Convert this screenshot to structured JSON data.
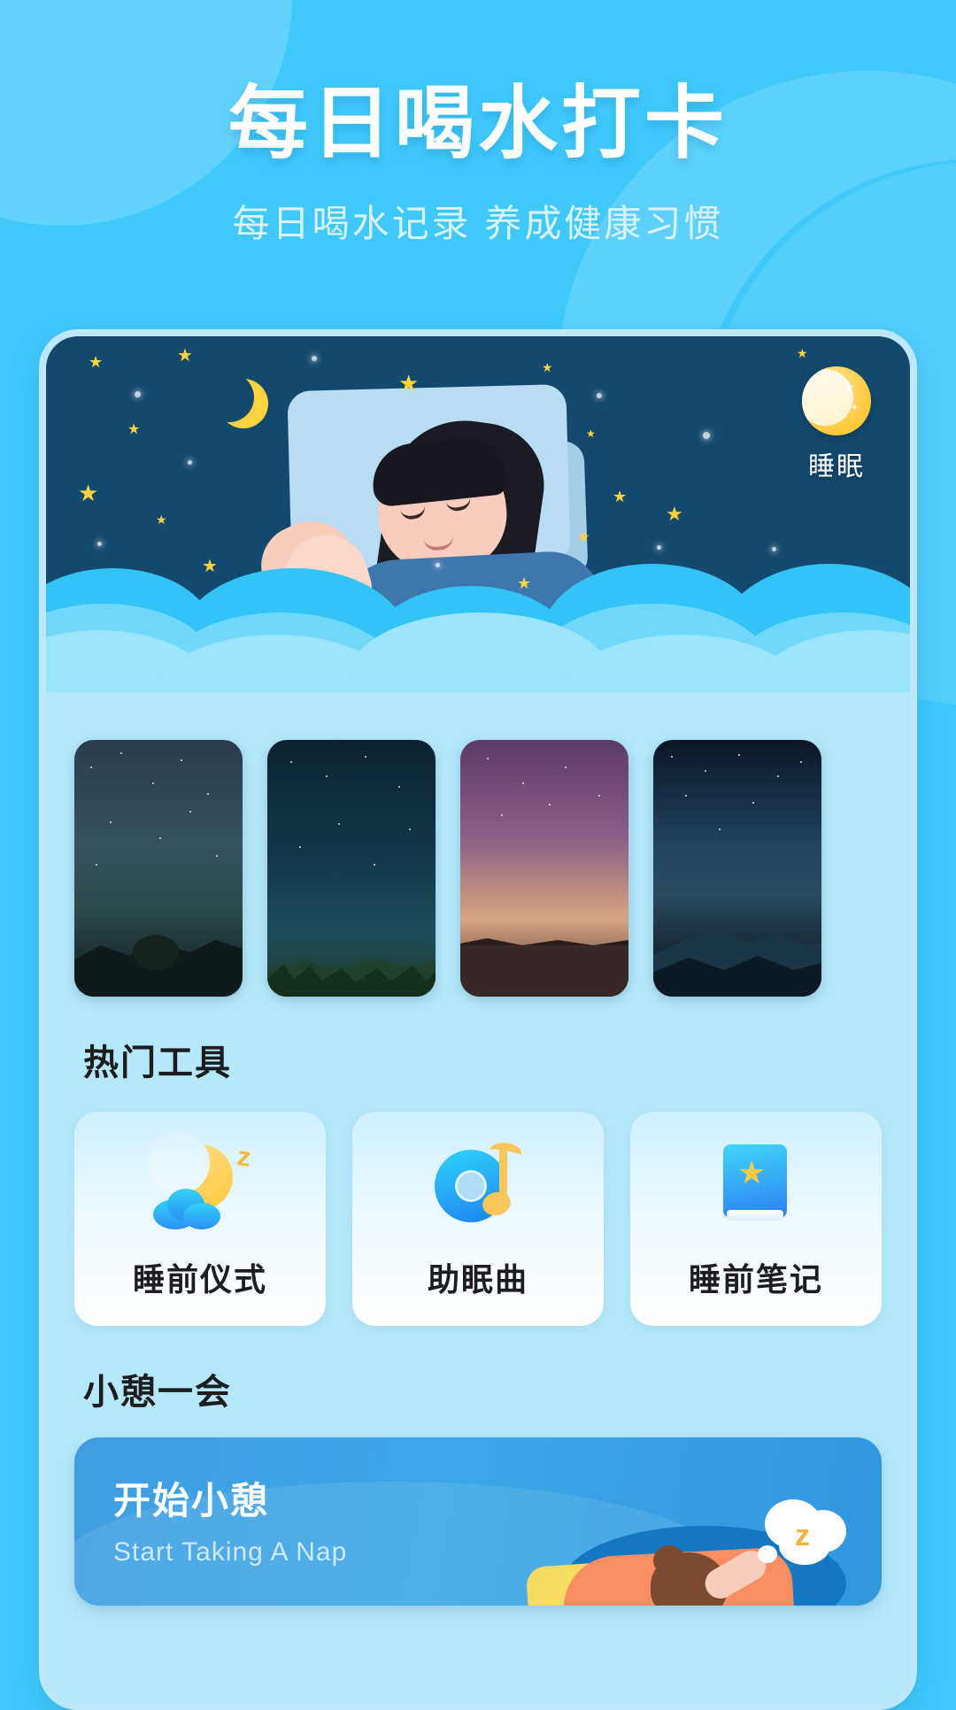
{
  "header": {
    "title": "每日喝水打卡",
    "subtitle": "每日喝水记录 养成健康习惯"
  },
  "hero": {
    "badge_label": "睡眠",
    "badge_icon": "crescent-moon-icon",
    "illustration": "sleeping-woman-night-sky"
  },
  "gallery": {
    "items": [
      {
        "name": "milky-way-lone-tree-lake"
      },
      {
        "name": "starry-sky-pine-forest"
      },
      {
        "name": "purple-aurora-lake-reflection"
      },
      {
        "name": "starry-sky-mountain-range"
      }
    ]
  },
  "tools_section": {
    "title": "热门工具",
    "items": [
      {
        "label": "睡前仪式",
        "icon": "moon-cloud-sleep-icon"
      },
      {
        "label": "助眠曲",
        "icon": "music-record-note-icon"
      },
      {
        "label": "睡前笔记",
        "icon": "book-star-icon"
      }
    ]
  },
  "nap_section": {
    "title": "小憩一会",
    "card": {
      "title": "开始小憩",
      "subtitle": "Start Taking A Nap",
      "illustration": "person-napping-z-cloud"
    }
  },
  "colors": {
    "background": "#3FC9FB",
    "panel": "#B6E8FB",
    "night_sky": "#14496E",
    "accent_yellow": "#FFD23F",
    "nap_card": "#3AA7E6",
    "text_dark": "#1D1D1F",
    "text_light": "#D8F3FF"
  }
}
